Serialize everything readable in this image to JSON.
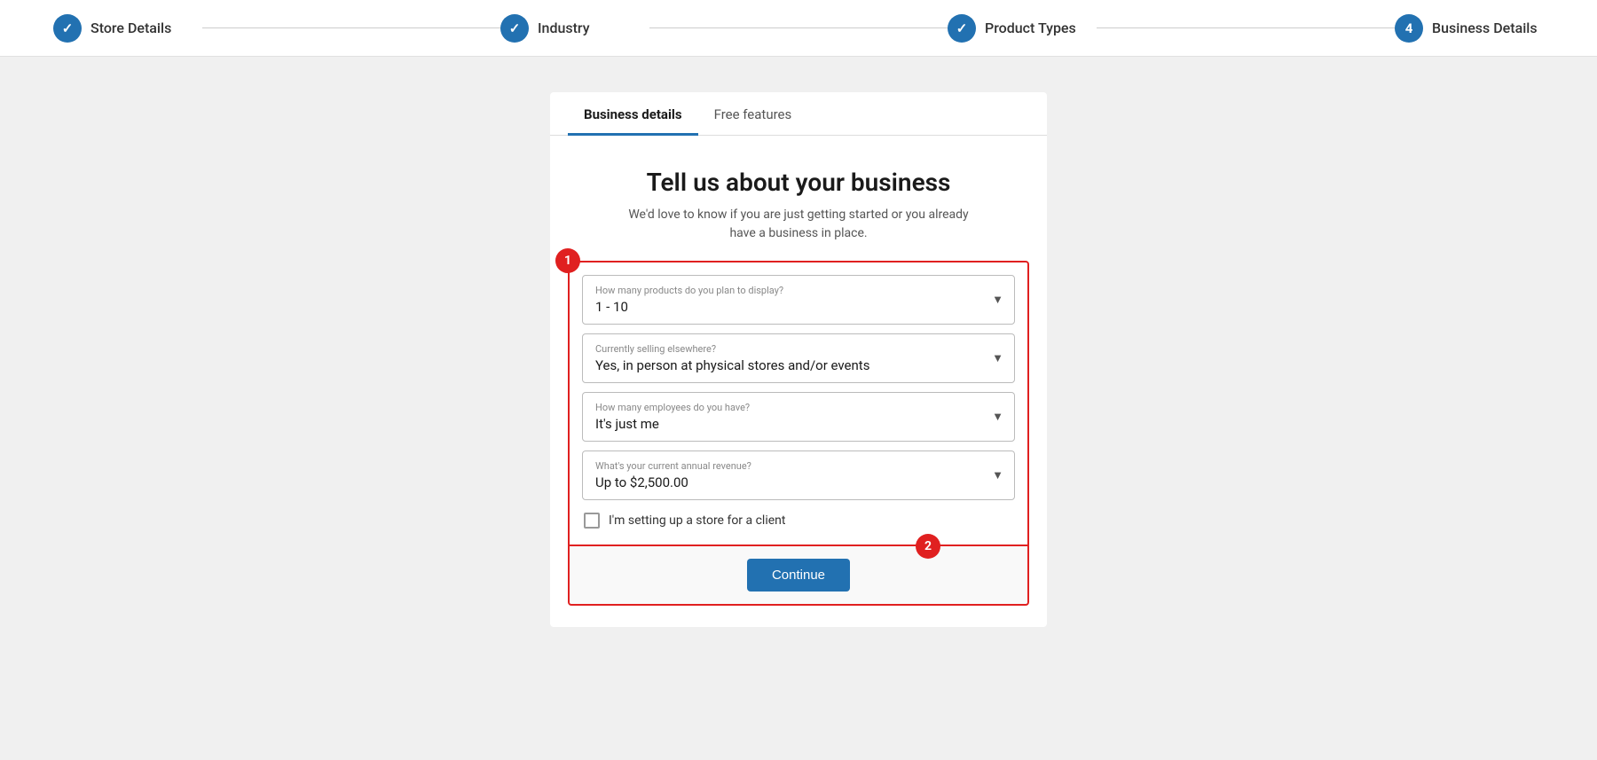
{
  "stepper": {
    "steps": [
      {
        "id": "store-details",
        "label": "Store Details",
        "icon": "✓",
        "state": "completed"
      },
      {
        "id": "industry",
        "label": "Industry",
        "icon": "✓",
        "state": "completed"
      },
      {
        "id": "product-types",
        "label": "Product Types",
        "icon": "✓",
        "state": "completed"
      },
      {
        "id": "business-details",
        "label": "Business Details",
        "icon": "4",
        "state": "active"
      }
    ]
  },
  "tabs": [
    {
      "id": "business-details",
      "label": "Business details",
      "active": true
    },
    {
      "id": "free-features",
      "label": "Free features",
      "active": false
    }
  ],
  "heading": {
    "title": "Tell us about your business",
    "subtitle": "We'd love to know if you are just getting started or you already have a business in place."
  },
  "form": {
    "fields": [
      {
        "id": "products-count",
        "label": "How many products do you plan to display?",
        "value": "1 - 10"
      },
      {
        "id": "selling-elsewhere",
        "label": "Currently selling elsewhere?",
        "value": "Yes, in person at physical stores and/or events"
      },
      {
        "id": "employees",
        "label": "How many employees do you have?",
        "value": "It's just me"
      },
      {
        "id": "annual-revenue",
        "label": "What's your current annual revenue?",
        "value": "Up to $2,500.00"
      }
    ],
    "checkbox": {
      "label": "I'm setting up a store for a client",
      "checked": false
    }
  },
  "buttons": {
    "continue": "Continue"
  },
  "badges": {
    "form_badge": "1",
    "continue_badge": "2"
  }
}
